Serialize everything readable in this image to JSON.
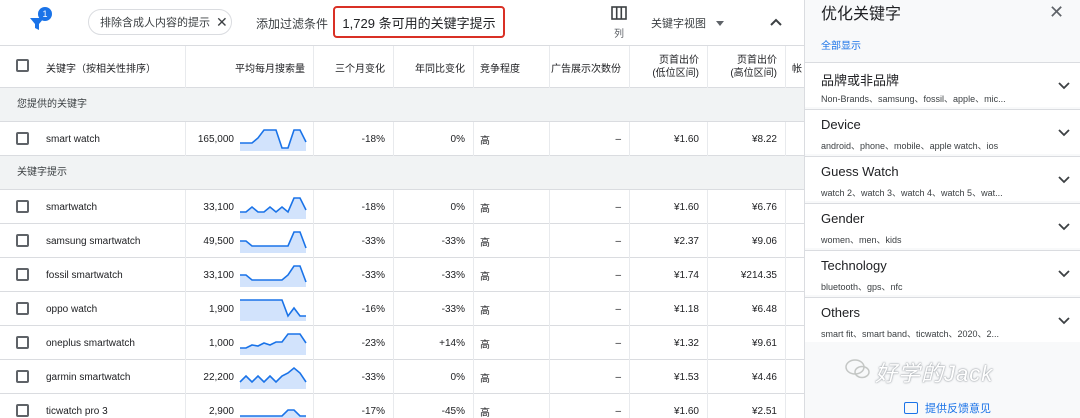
{
  "toolbar": {
    "filter_badge": "1",
    "chip_label": "排除含成人内容的提示",
    "chip_close": "✕",
    "add_filter": "添加过滤条件",
    "count_label": "1,729 条可用的关键字提示",
    "columns_label": "列",
    "view_label": "关键字视图"
  },
  "table": {
    "headers": {
      "keyword": "关键字（按相关性排序）",
      "avg_searches": "平均每月搜索量",
      "three_month": "三个月变化",
      "yoy": "年同比变化",
      "competition": "竞争程度",
      "impression_share": "广告展示次数份",
      "bid_low_line1": "页首出价",
      "bid_low_line2": "(低位区间)",
      "bid_high_line1": "页首出价",
      "bid_high_line2": "(高位区间)",
      "extra": "帐"
    },
    "section_provided": "您提供的关键字",
    "section_suggestions": "关键字提示",
    "provided_rows": [
      {
        "keyword": "smart watch",
        "searches": "165,000",
        "three_month": "-18%",
        "yoy": "0%",
        "competition": "高",
        "impression": "–",
        "bid_low": "¥1.60",
        "bid_high": "¥8.22",
        "trend": [
          0.35,
          0.35,
          0.35,
          0.6,
          1.0,
          1.0,
          1.0,
          0.1,
          0.1,
          1.0,
          1.0,
          0.4
        ]
      }
    ],
    "suggestion_rows": [
      {
        "keyword": "smartwatch",
        "searches": "33,100",
        "three_month": "-18%",
        "yoy": "0%",
        "competition": "高",
        "impression": "–",
        "bid_low": "¥1.60",
        "bid_high": "¥6.76",
        "trend": [
          0.3,
          0.3,
          0.55,
          0.3,
          0.3,
          0.55,
          0.3,
          0.55,
          0.3,
          1.0,
          1.0,
          0.4
        ]
      },
      {
        "keyword": "samsung smartwatch",
        "searches": "49,500",
        "three_month": "-33%",
        "yoy": "-33%",
        "competition": "高",
        "impression": "–",
        "bid_low": "¥2.37",
        "bid_high": "¥9.06",
        "trend": [
          0.55,
          0.55,
          0.3,
          0.3,
          0.3,
          0.3,
          0.3,
          0.3,
          0.3,
          1.0,
          1.0,
          0.2
        ]
      },
      {
        "keyword": "fossil smartwatch",
        "searches": "33,100",
        "three_month": "-33%",
        "yoy": "-33%",
        "competition": "高",
        "impression": "–",
        "bid_low": "¥1.74",
        "bid_high": "¥214.35",
        "trend": [
          0.55,
          0.55,
          0.3,
          0.3,
          0.3,
          0.3,
          0.3,
          0.3,
          0.55,
          1.0,
          1.0,
          0.2
        ]
      },
      {
        "keyword": "oppo watch",
        "searches": "1,900",
        "three_month": "-16%",
        "yoy": "-33%",
        "competition": "高",
        "impression": "–",
        "bid_low": "¥1.18",
        "bid_high": "¥6.48",
        "trend": [
          1.0,
          1.0,
          1.0,
          1.0,
          1.0,
          1.0,
          1.0,
          1.0,
          0.2,
          0.6,
          0.2,
          0.2
        ]
      },
      {
        "keyword": "oneplus smartwatch",
        "searches": "1,000",
        "three_month": "-23%",
        "yoy": "+14%",
        "competition": "高",
        "impression": "–",
        "bid_low": "¥1.32",
        "bid_high": "¥9.61",
        "trend": [
          0.3,
          0.3,
          0.45,
          0.4,
          0.55,
          0.45,
          0.6,
          0.6,
          1.0,
          1.0,
          1.0,
          0.55
        ]
      },
      {
        "keyword": "garmin smartwatch",
        "searches": "22,200",
        "three_month": "-33%",
        "yoy": "0%",
        "competition": "高",
        "impression": "–",
        "bid_low": "¥1.53",
        "bid_high": "¥4.46",
        "trend": [
          0.3,
          0.6,
          0.3,
          0.6,
          0.3,
          0.6,
          0.3,
          0.6,
          0.75,
          1.0,
          0.75,
          0.3
        ]
      },
      {
        "keyword": "ticwatch pro 3",
        "searches": "2,900",
        "three_month": "-17%",
        "yoy": "-45%",
        "competition": "高",
        "impression": "–",
        "bid_low": "¥1.60",
        "bid_high": "¥2.51",
        "trend": [
          0.3,
          0.3,
          0.3,
          0.3,
          0.3,
          0.3,
          0.3,
          0.3,
          0.6,
          0.6,
          0.3,
          0.3
        ]
      }
    ]
  },
  "panel": {
    "title": "优化关键字",
    "close": "✕",
    "show_all": "全部显示",
    "groups": [
      {
        "title": "品牌或非品牌",
        "sub": "Non-Brands、samsung、fossil、apple、mic..."
      },
      {
        "title": "Device",
        "sub": "android、phone、mobile、apple watch、ios"
      },
      {
        "title": "Guess Watch",
        "sub": "watch 2、watch 3、watch 4、watch 5、wat..."
      },
      {
        "title": "Gender",
        "sub": "women、men、kids"
      },
      {
        "title": "Technology",
        "sub": "bluetooth、gps、nfc"
      },
      {
        "title": "Others",
        "sub": "smart fit、smart band、ticwatch、2020、2..."
      }
    ],
    "feedback": "提供反馈意见",
    "watermark": "好学的Jack"
  },
  "colors": {
    "accent": "#1a73e8",
    "highlight_border": "#d93025",
    "spark_line": "#1a73e8",
    "spark_fill": "#d2e3fc"
  }
}
